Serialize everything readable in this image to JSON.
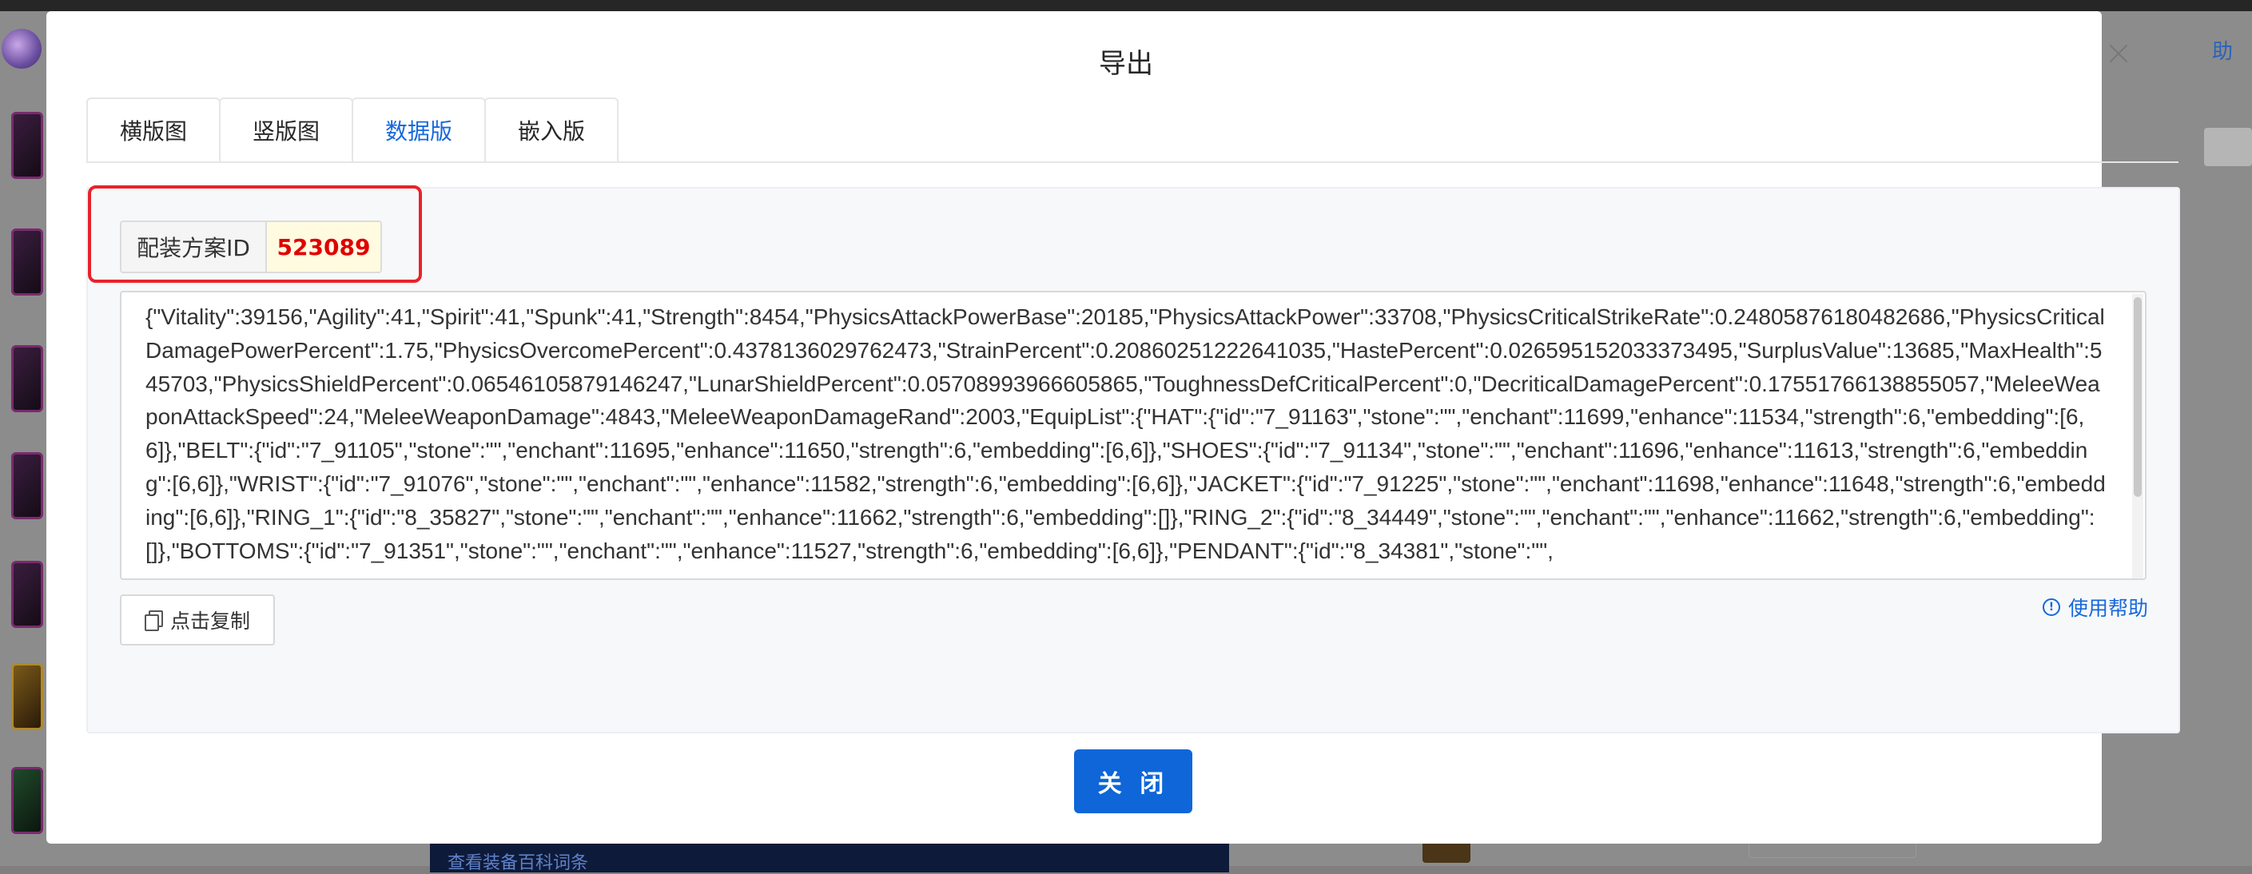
{
  "modal": {
    "title": "导出",
    "tabs": [
      "横版图",
      "竖版图",
      "数据版",
      "嵌入版"
    ],
    "active_tab_index": 2,
    "config_id_label": "配装方案ID",
    "config_id_value": "523089",
    "data_text": "{\"Vitality\":39156,\"Agility\":41,\"Spirit\":41,\"Spunk\":41,\"Strength\":8454,\"PhysicsAttackPowerBase\":20185,\"PhysicsAttackPower\":33708,\"PhysicsCriticalStrikeRate\":0.24805876180482686,\"PhysicsCriticalDamagePowerPercent\":1.75,\"PhysicsOvercomePercent\":0.4378136029762473,\"StrainPercent\":0.20860251222641035,\"HastePercent\":0.026595152033373495,\"SurplusValue\":13685,\"MaxHealth\":545703,\"PhysicsShieldPercent\":0.06546105879146247,\"LunarShieldPercent\":0.05708993966605865,\"ToughnessDefCriticalPercent\":0,\"DecriticalDamagePercent\":0.17551766138855057,\"MeleeWeaponAttackSpeed\":24,\"MeleeWeaponDamage\":4843,\"MeleeWeaponDamageRand\":2003,\"EquipList\":{\"HAT\":{\"id\":\"7_91163\",\"stone\":\"\",\"enchant\":11699,\"enhance\":11534,\"strength\":6,\"embedding\":[6,6]},\"BELT\":{\"id\":\"7_91105\",\"stone\":\"\",\"enchant\":11695,\"enhance\":11650,\"strength\":6,\"embedding\":[6,6]},\"SHOES\":{\"id\":\"7_91134\",\"stone\":\"\",\"enchant\":11696,\"enhance\":11613,\"strength\":6,\"embedding\":[6,6]},\"WRIST\":{\"id\":\"7_91076\",\"stone\":\"\",\"enchant\":\"\",\"enhance\":11582,\"strength\":6,\"embedding\":[6,6]},\"JACKET\":{\"id\":\"7_91225\",\"stone\":\"\",\"enchant\":11698,\"enhance\":11648,\"strength\":6,\"embedding\":[6,6]},\"RING_1\":{\"id\":\"8_35827\",\"stone\":\"\",\"enchant\":\"\",\"enhance\":11662,\"strength\":6,\"embedding\":[]},\"RING_2\":{\"id\":\"8_34449\",\"stone\":\"\",\"enchant\":\"\",\"enhance\":11662,\"strength\":6,\"embedding\":[]},\"BOTTOMS\":{\"id\":\"7_91351\",\"stone\":\"\",\"enchant\":\"\",\"enhance\":11527,\"strength\":6,\"embedding\":[6,6]},\"PENDANT\":{\"id\":\"8_34381\",\"stone\":\"\",",
    "copy_label": "点击复制",
    "help_label": "使用帮助",
    "close_label": "关 闭"
  },
  "background": {
    "right_label": "助",
    "bottom_link": "查看装备百科词条"
  },
  "colors": {
    "accent": "#0e66d9",
    "highlight_border": "#e8232a",
    "id_value": "#e00000"
  }
}
